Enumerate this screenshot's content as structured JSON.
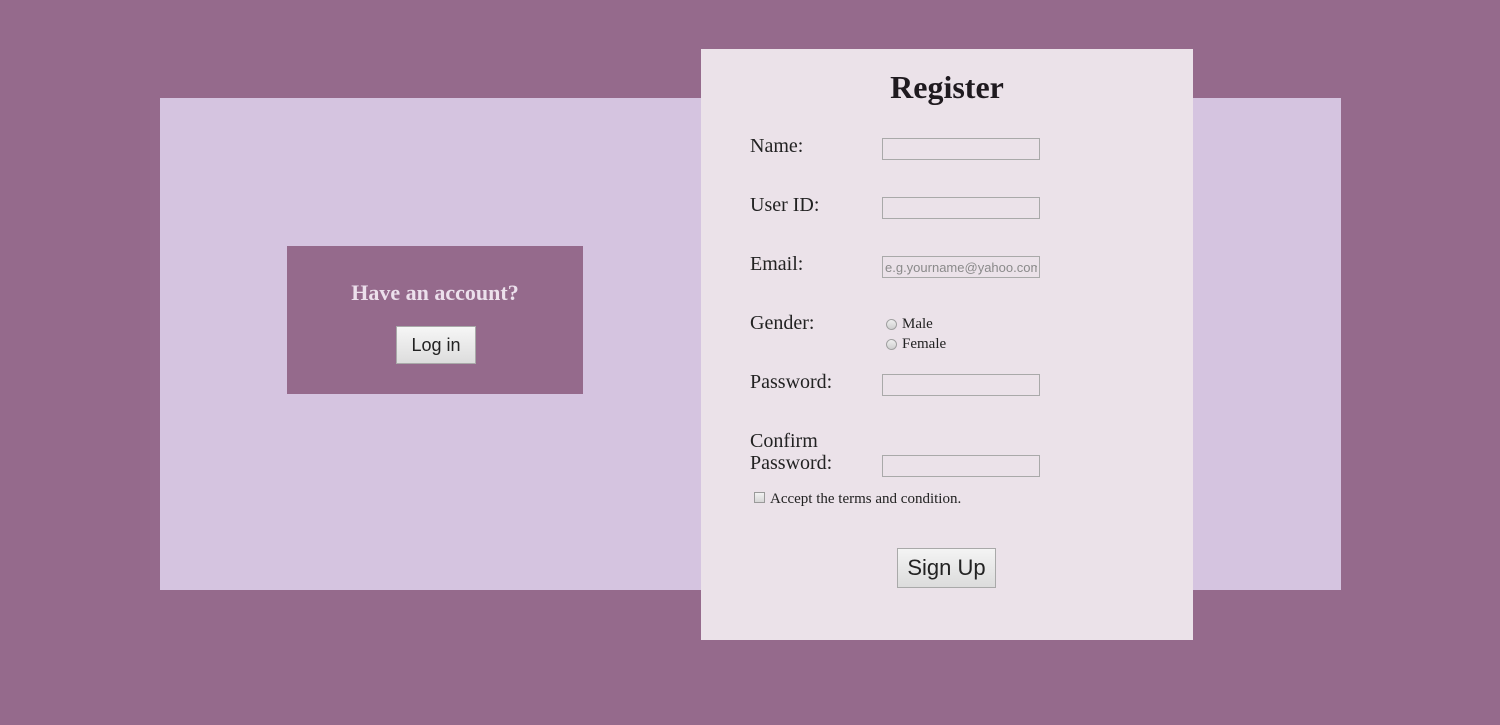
{
  "login": {
    "heading": "Have an account?",
    "button_label": "Log in"
  },
  "register": {
    "title": "Register",
    "fields": {
      "name": {
        "label": "Name:",
        "value": ""
      },
      "user_id": {
        "label": "User ID:",
        "value": ""
      },
      "email": {
        "label": "Email:",
        "value": "",
        "placeholder": "e.g.yourname@yahoo.com"
      },
      "gender": {
        "label": "Gender:",
        "options": [
          "Male",
          "Female"
        ]
      },
      "password": {
        "label": "Password:",
        "value": ""
      },
      "confirm_password": {
        "label_line1": "Confirm",
        "label_line2": "Password:",
        "value": ""
      }
    },
    "terms_label": "Accept the terms and condition.",
    "signup_label": "Sign Up"
  },
  "colors": {
    "page_background": "#956a8c",
    "backdrop_panel": "#d5c4e0",
    "login_box": "#956a8c",
    "register_card": "#ebe2e9"
  }
}
